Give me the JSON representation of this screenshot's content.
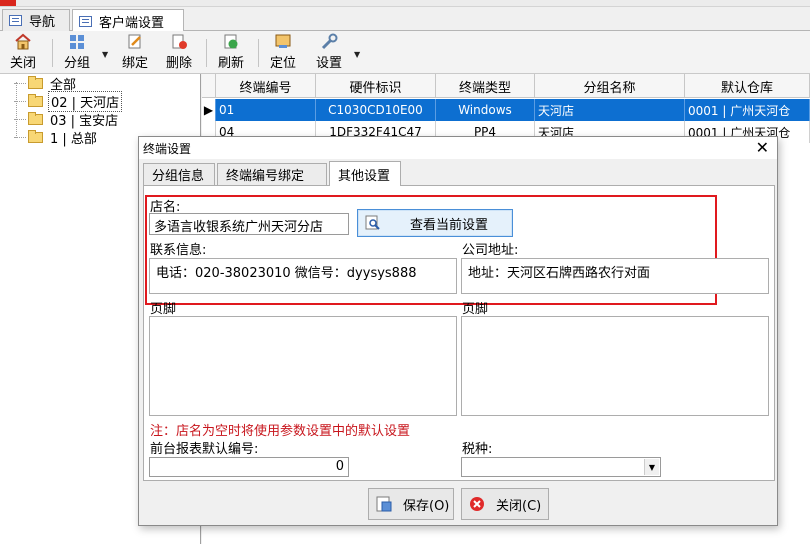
{
  "tabs": [
    {
      "label": "导航"
    },
    {
      "label": "客户端设置"
    }
  ],
  "toolbar": {
    "close": "关闭",
    "group": "分组",
    "bind": "绑定",
    "delete": "删除",
    "refresh": "刷新",
    "locate": "定位",
    "settings": "设置"
  },
  "tree": {
    "items": [
      {
        "label": "全部"
      },
      {
        "label": "02 | 天河店"
      },
      {
        "label": "03 | 宝安店"
      },
      {
        "label": "1 | 总部"
      }
    ]
  },
  "grid": {
    "columns": [
      "终端编号",
      "硬件标识",
      "终端类型",
      "分组名称",
      "默认仓库"
    ],
    "rows": [
      [
        "01",
        "C1030CD10E00",
        "Windows",
        "天河店",
        "0001 | 广州天河仓"
      ],
      [
        "04",
        "1DF332F41C47",
        "PP4",
        "天河店",
        "0001 | 广州天河仓"
      ]
    ]
  },
  "dialog": {
    "title": "终端设置",
    "tabs": [
      "分组信息",
      "终端编号绑定",
      "其他设置"
    ],
    "store_label": "店名:",
    "store_value": "多语言收银系统广州天河分店",
    "view_settings_button": "查看当前设置",
    "contact_label": "联系信息:",
    "contact_value": "电话：020-38023010  微信号：dyysys888",
    "address_label": "公司地址:",
    "address_value": "地址：天河区石牌西路农行对面",
    "footer_label_left": "页脚",
    "footer_label_right": "页脚",
    "note": "注：店名为空时将使用参数设置中的默认设置",
    "report_label": "前台报表默认编号:",
    "report_value": "0",
    "tax_label": "税种:",
    "save_button": "保存(O)",
    "close_button": "关闭(C)"
  },
  "colors": {
    "selection": "#0d6fd1",
    "highlight_box": "#e0191e",
    "note_text": "#c8161d"
  }
}
